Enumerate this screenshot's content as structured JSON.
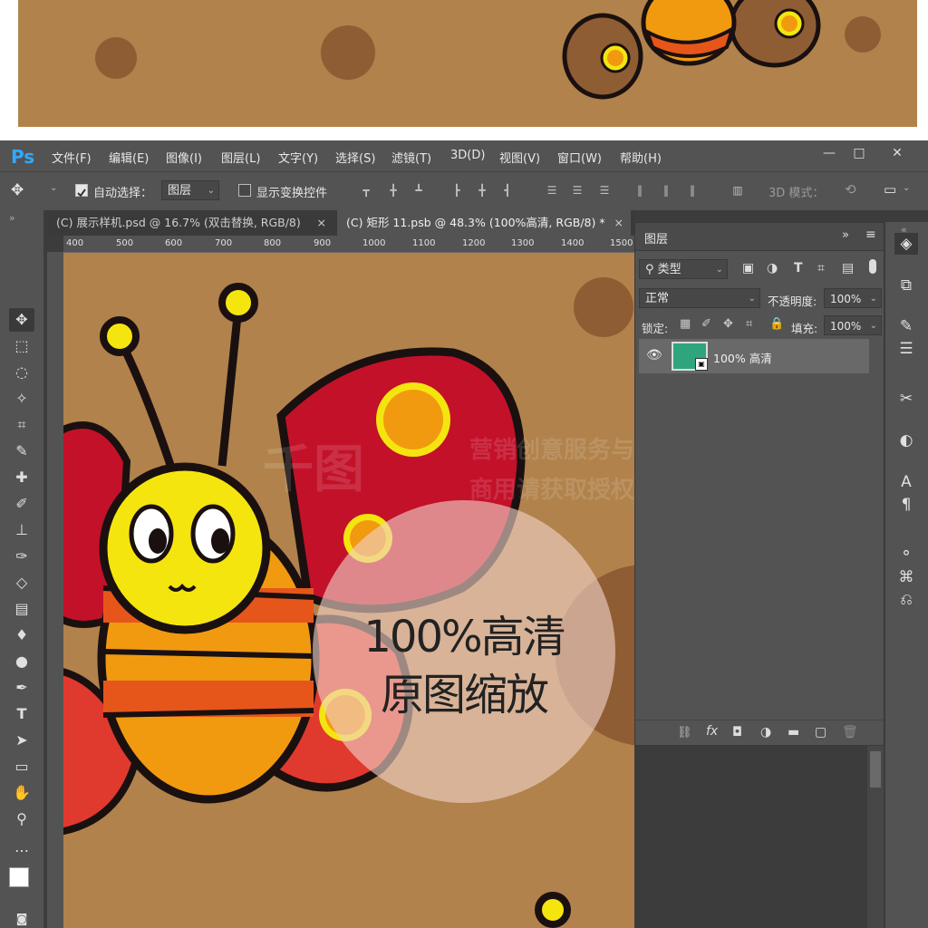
{
  "app": {
    "logo": "Ps"
  },
  "menu": [
    "文件(F)",
    "编辑(E)",
    "图像(I)",
    "图层(L)",
    "文字(Y)",
    "选择(S)",
    "滤镜(T)",
    "3D(D)",
    "视图(V)",
    "窗口(W)",
    "帮助(H)"
  ],
  "window_controls": {
    "minimize": "—",
    "maximize": "□",
    "close": "✕"
  },
  "options": {
    "auto_select_label": "自动选择：",
    "auto_select_checked": true,
    "auto_select_target": "图层",
    "show_transform_label": "显示变换控件",
    "show_transform_checked": false,
    "mode_label": "3D 模式："
  },
  "tabs": [
    {
      "label": "(C) 展示样机.psd @ 16.7% (双击替换, RGB/8)",
      "close": "×",
      "active": false
    },
    {
      "label": "(C) 矩形 11.psb @ 48.3% (100%高清, RGB/8) *",
      "close": "×",
      "active": true
    }
  ],
  "ruler": {
    "top_ticks": [
      "400",
      "500",
      "600",
      "700",
      "800",
      "900",
      "1000",
      "1100",
      "1200",
      "1300",
      "1400",
      "1500"
    ]
  },
  "layers_panel": {
    "title": "图层",
    "filter_kind": "类型",
    "blend_mode": "正常",
    "opacity_label": "不透明度:",
    "opacity_value": "100%",
    "lock_label": "锁定:",
    "fill_label": "填充:",
    "fill_value": "100%",
    "layers": [
      {
        "name": "100% 高清",
        "visible": true,
        "thumb_color": "#2ea57c"
      }
    ]
  },
  "overlay": {
    "line1": "100%高清",
    "line2": "原图缩放"
  },
  "watermark": {
    "line1": "营销创意服务与协作平台",
    "line2": "商用请获取授权",
    "logo": "千图"
  },
  "colors": {
    "canvas_bg": "#b1824b",
    "ui_dark": "#535353",
    "ps_blue": "#31a8ff",
    "wing_red": "#c3112a",
    "body_yellow": "#f7ec14"
  }
}
